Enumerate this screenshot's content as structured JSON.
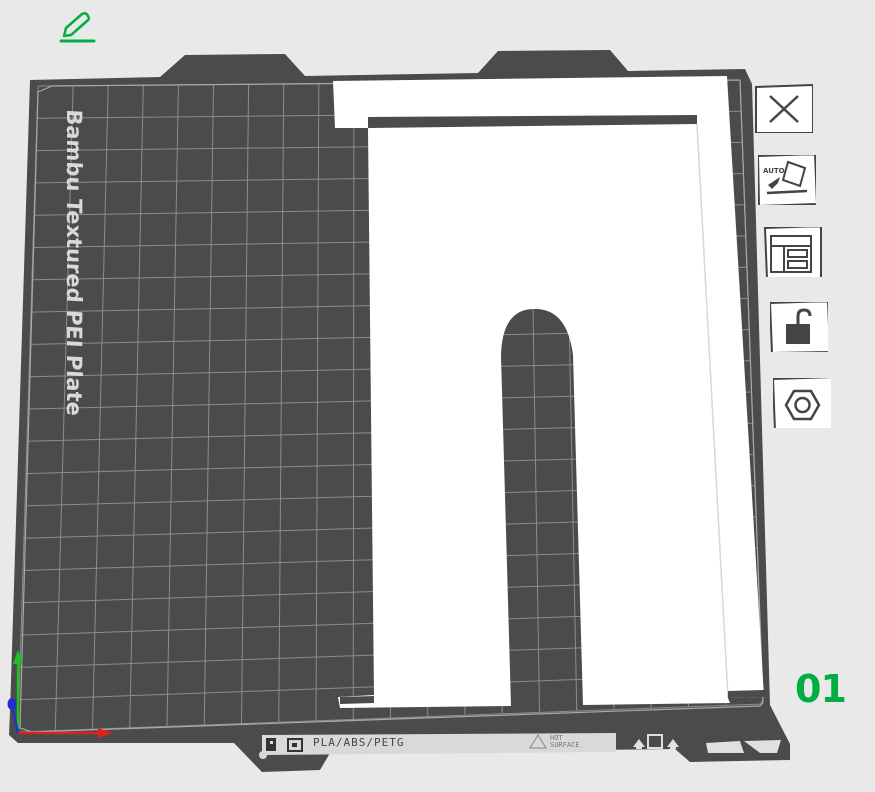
{
  "plate": {
    "name": "Bambu Textured PEI Plate",
    "number": "01",
    "filament_label": "PLA/ABS/PETG",
    "hot_label_line1": "HOT",
    "hot_label_line2": "SURFACE"
  },
  "colors": {
    "background": "#e9e9e9",
    "bed": "#4a4b4b",
    "grid": "#8c8c8c",
    "model": "#ffffff",
    "accent": "#00ae42",
    "axis_x": "#e02020",
    "axis_y": "#20c020",
    "axis_z": "#2030d0"
  },
  "toolbar": {
    "edit_icon": "pencil-icon",
    "buttons": [
      {
        "name": "delete-plate-button",
        "icon": "close-icon"
      },
      {
        "name": "auto-orient-button",
        "icon": "auto-orient-icon"
      },
      {
        "name": "arrange-button",
        "icon": "arrange-icon"
      },
      {
        "name": "lock-plate-button",
        "icon": "lock-icon"
      },
      {
        "name": "plate-settings-button",
        "icon": "hexagon-nut-icon"
      }
    ]
  }
}
